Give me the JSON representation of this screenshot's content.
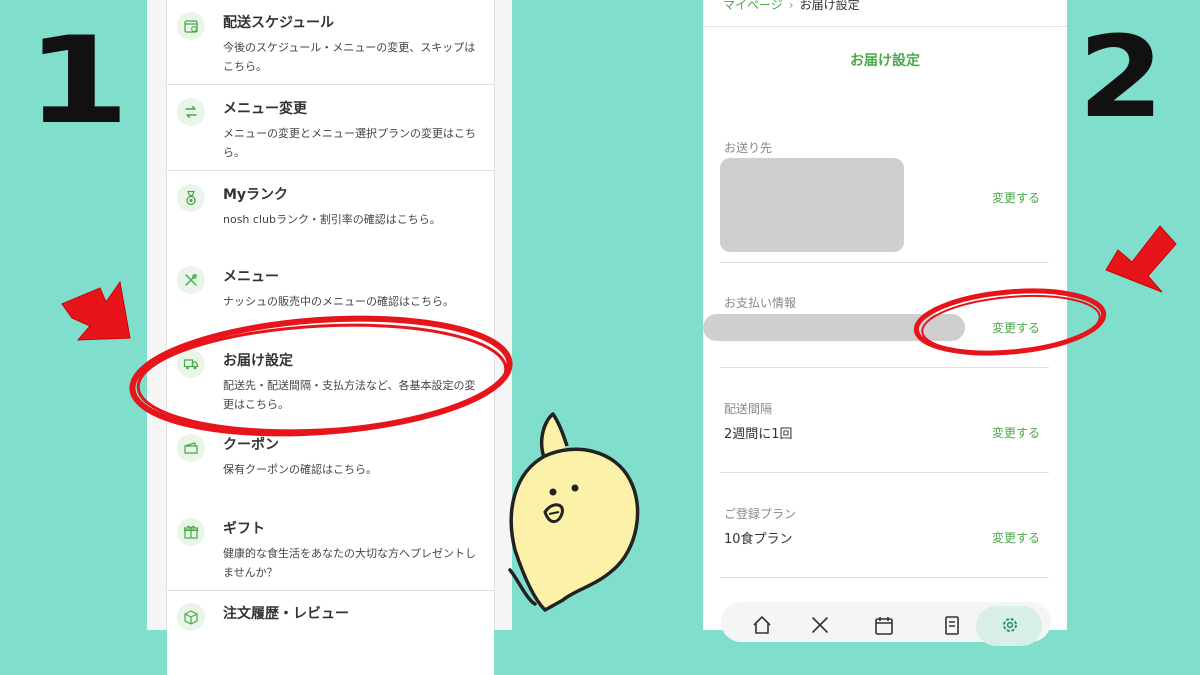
{
  "steps": {
    "first": "1",
    "second": "2"
  },
  "menu": {
    "items": [
      {
        "icon": "calendar-icon",
        "title": "配送スケジュール",
        "desc": "今後のスケジュール・メニューの変更、スキップはこちら。"
      },
      {
        "icon": "swap-icon",
        "title": "メニュー変更",
        "desc": "メニューの変更とメニュー選択プランの変更はこちら。"
      },
      {
        "icon": "medal-icon",
        "title": "Myランク",
        "desc": "nosh clubランク・割引率の確認はこちら。"
      },
      {
        "icon": "cutlery-icon",
        "title": "メニュー",
        "desc": "ナッシュの販売中のメニューの確認はこちら。"
      },
      {
        "icon": "delivery-truck-icon",
        "title": "お届け設定",
        "desc": "配送先・配送間隔・支払方法など、各基本設定の変更はこちら。"
      },
      {
        "icon": "coupon-icon",
        "title": "クーポン",
        "desc": "保有クーポンの確認はこちら。"
      },
      {
        "icon": "gift-icon",
        "title": "ギフト",
        "desc": "健康的な食生活をあなたの大切な方へプレゼントしませんか？"
      },
      {
        "icon": "box-icon",
        "title": "注文履歴・レビュー",
        "desc": ""
      }
    ]
  },
  "settings": {
    "breadcrumb_home": "マイページ",
    "breadcrumb_sep": "›",
    "breadcrumb_current": "お届け設定",
    "title": "お届け設定",
    "change_label": "変更する",
    "fields": [
      {
        "label": "お送り先",
        "value": ""
      },
      {
        "label": "お支払い情報",
        "value": ""
      },
      {
        "label": "配送間隔",
        "value": "2週間に1回"
      },
      {
        "label": "ご登録プラン",
        "value": "10食プラン"
      }
    ]
  },
  "colors": {
    "background": "#80dfcc",
    "accent_green": "#4aa84a",
    "annotation_red": "#e8141b",
    "chick_yellow": "#fbf1a8"
  },
  "bottom_nav": {
    "icons": [
      "home-icon",
      "cutlery-icon",
      "calendar-icon",
      "document-icon",
      "gear-icon"
    ],
    "active": "gear-icon"
  }
}
